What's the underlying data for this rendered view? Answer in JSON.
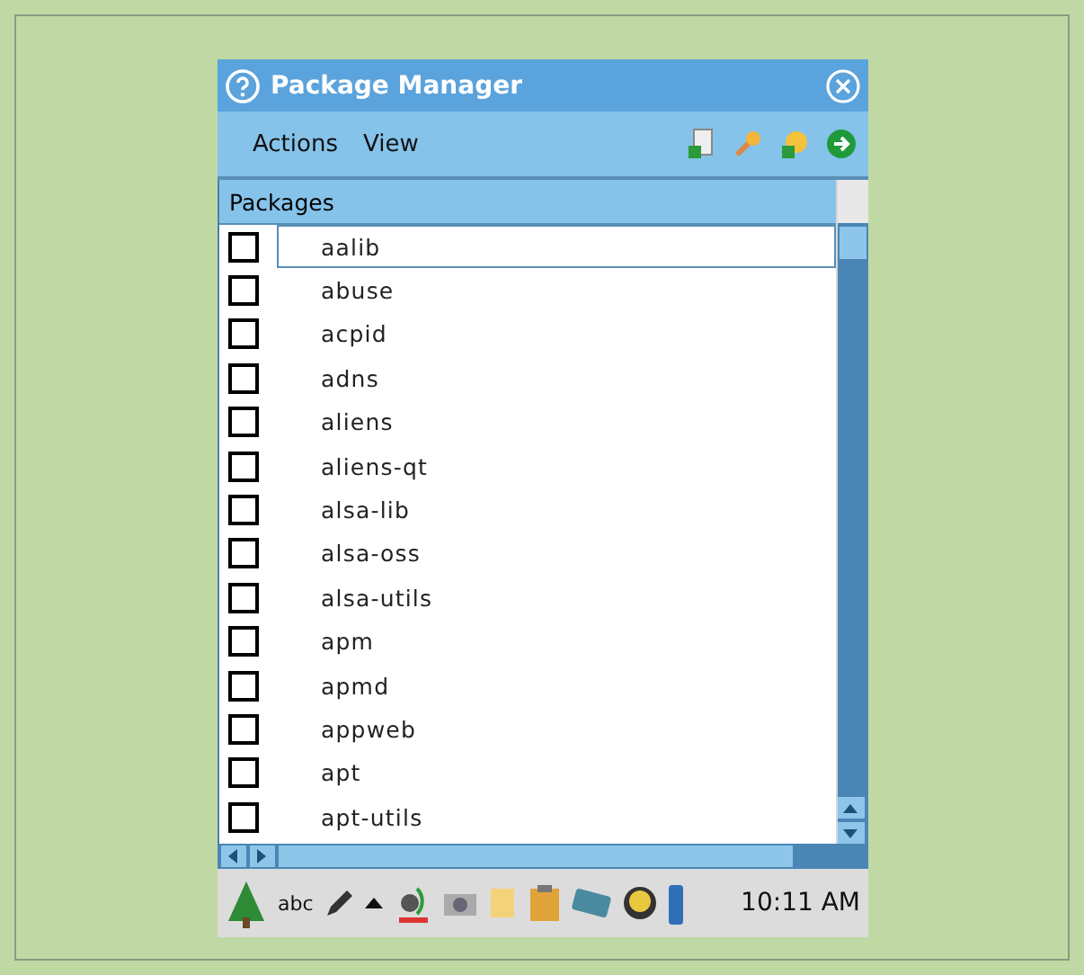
{
  "window": {
    "title": "Package Manager"
  },
  "menu": [
    {
      "label": "Actions"
    },
    {
      "label": "View"
    }
  ],
  "list": {
    "header": "Packages",
    "items": [
      {
        "name": "aalib",
        "checked": false,
        "current": true
      },
      {
        "name": "abuse",
        "checked": false,
        "current": false
      },
      {
        "name": "acpid",
        "checked": false,
        "current": false
      },
      {
        "name": "adns",
        "checked": false,
        "current": false
      },
      {
        "name": "aliens",
        "checked": false,
        "current": false
      },
      {
        "name": "aliens-qt",
        "checked": false,
        "current": false
      },
      {
        "name": "alsa-lib",
        "checked": false,
        "current": false
      },
      {
        "name": "alsa-oss",
        "checked": false,
        "current": false
      },
      {
        "name": "alsa-utils",
        "checked": false,
        "current": false
      },
      {
        "name": "apm",
        "checked": false,
        "current": false
      },
      {
        "name": "apmd",
        "checked": false,
        "current": false
      },
      {
        "name": "appweb",
        "checked": false,
        "current": false
      },
      {
        "name": "apt",
        "checked": false,
        "current": false
      },
      {
        "name": "apt-utils",
        "checked": false,
        "current": false
      }
    ]
  },
  "taskbar": {
    "input_label": "abc",
    "clock": "10:11 AM"
  }
}
